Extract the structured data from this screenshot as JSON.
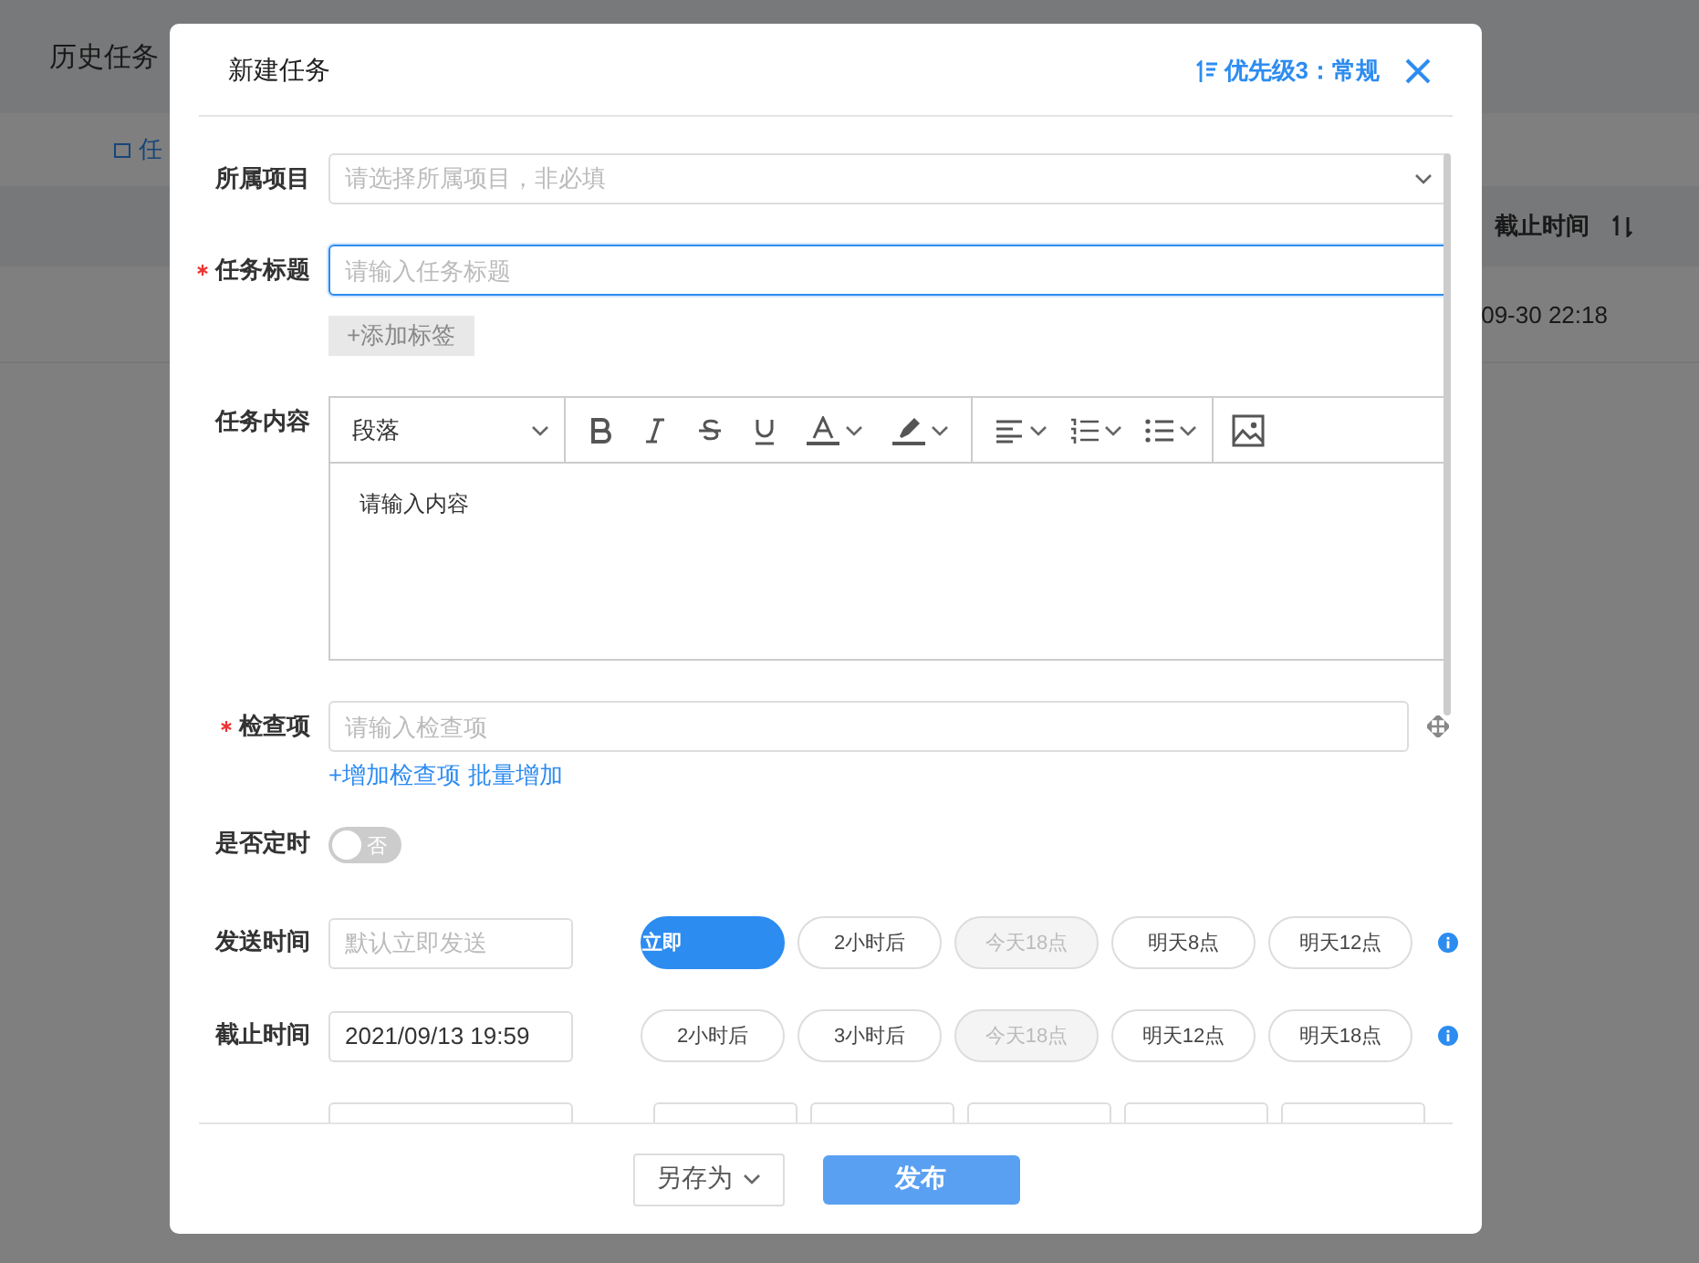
{
  "background": {
    "tab": "历史任务",
    "toolbar_item": "任",
    "column_header": "截止时间",
    "cell": "09-30 22:18"
  },
  "dialog": {
    "title": "新建任务",
    "priority": "优先级3：常规",
    "fields": [
      {
        "kind": "select",
        "label": "所属项目",
        "required": false,
        "placeholder": "请选择所属项目，非必填"
      },
      {
        "kind": "input",
        "label": "任务标题",
        "required": true,
        "placeholder": "请输入任务标题",
        "focused": true,
        "tag_button": "+添加标签"
      },
      {
        "kind": "editor",
        "label": "任务内容",
        "required": false,
        "block_format": "段落",
        "placeholder": "请输入内容"
      },
      {
        "kind": "checklist",
        "label": "检查项",
        "required": true,
        "placeholder": "请输入检查项",
        "links": [
          "+增加检查项",
          "批量增加"
        ]
      },
      {
        "kind": "toggle",
        "label": "是否定时",
        "required": false,
        "on": false,
        "state_text": "否"
      },
      {
        "kind": "time",
        "label": "发送时间",
        "required": false,
        "placeholder": "默认立即发送",
        "buttons": [
          {
            "label": "立即",
            "selected": true,
            "disabled": false
          },
          {
            "label": "2小时后",
            "selected": false,
            "disabled": false
          },
          {
            "label": "今天18点",
            "selected": false,
            "disabled": true
          },
          {
            "label": "明天8点",
            "selected": false,
            "disabled": false
          },
          {
            "label": "明天12点",
            "selected": false,
            "disabled": false
          }
        ]
      },
      {
        "kind": "time",
        "label": "截止时间",
        "required": false,
        "value": "2021/09/13 19:59",
        "buttons": [
          {
            "label": "2小时后",
            "selected": false,
            "disabled": false
          },
          {
            "label": "3小时后",
            "selected": false,
            "disabled": false
          },
          {
            "label": "今天18点",
            "selected": false,
            "disabled": true
          },
          {
            "label": "明天12点",
            "selected": false,
            "disabled": false
          },
          {
            "label": "明天18点",
            "selected": false,
            "disabled": false
          }
        ]
      }
    ],
    "footer": {
      "save_as": "另存为",
      "publish": "发布"
    }
  }
}
